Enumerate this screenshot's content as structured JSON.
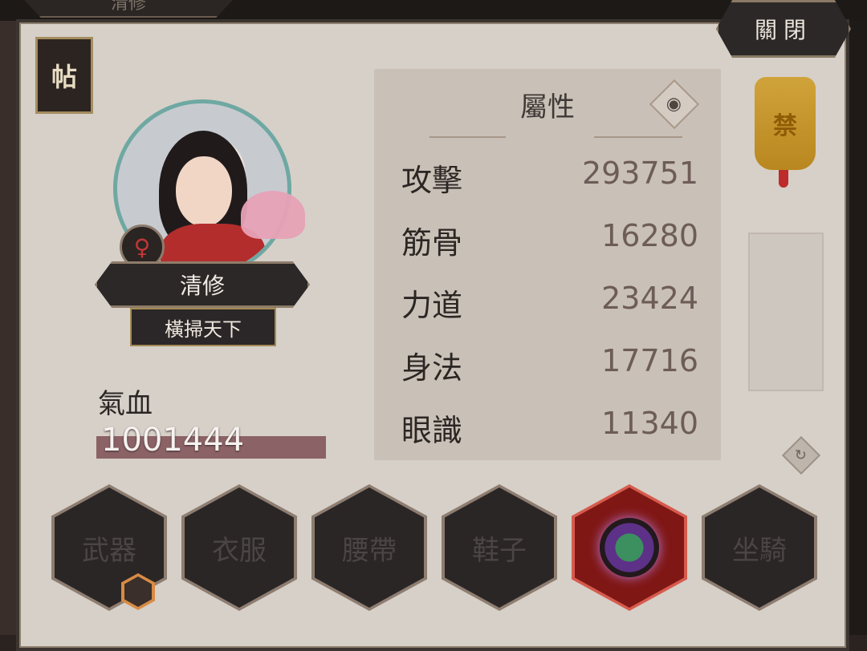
{
  "top_tab": "清修",
  "close_label": "關閉",
  "tie_label": "帖",
  "character": {
    "name": "清修",
    "title": "橫掃天下",
    "gender_symbol": "♀",
    "hp_label": "氣血",
    "hp_value": "1001444"
  },
  "attributes": {
    "title": "屬性",
    "rows": [
      {
        "name": "攻擊",
        "value": "293751"
      },
      {
        "name": "筋骨",
        "value": "16280"
      },
      {
        "name": "力道",
        "value": "23424"
      },
      {
        "name": "身法",
        "value": "17716"
      },
      {
        "name": "眼識",
        "value": "11340"
      }
    ]
  },
  "badge": {
    "text": "禁"
  },
  "equipment": [
    {
      "label": "武器"
    },
    {
      "label": "衣服"
    },
    {
      "label": "腰帶"
    },
    {
      "label": "鞋子"
    },
    {
      "label": ""
    },
    {
      "label": "坐騎"
    }
  ],
  "icons": {
    "eye": "eye-icon",
    "refresh": "refresh-icon",
    "gender": "female-icon"
  }
}
